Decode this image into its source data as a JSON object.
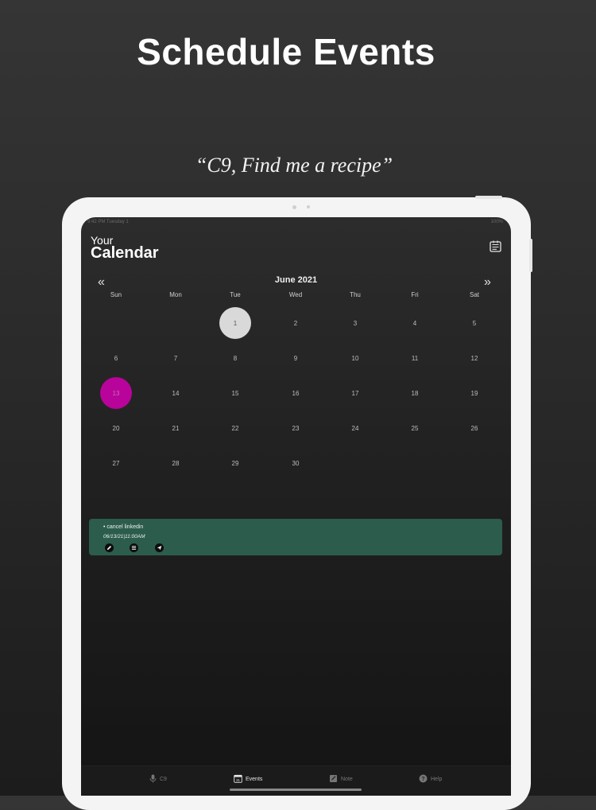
{
  "promo": {
    "headline": "Schedule Events",
    "quote": "“C9, Find me a recipe”"
  },
  "status_bar": {
    "left": "9:42 PM  Tuesday 1",
    "right": "100%"
  },
  "header": {
    "title_small": "Your",
    "title_big": "Calendar",
    "planner_icon": "planner-icon"
  },
  "calendar": {
    "month_label": "June 2021",
    "prev_label": "«",
    "next_label": "»",
    "weekdays": [
      "Sun",
      "Mon",
      "Tue",
      "Wed",
      "Thu",
      "Fri",
      "Sat"
    ],
    "today": "1",
    "selected": "13",
    "days": [
      "1",
      "2",
      "3",
      "4",
      "5",
      "6",
      "7",
      "8",
      "9",
      "10",
      "11",
      "12",
      "13",
      "14",
      "15",
      "16",
      "17",
      "18",
      "19",
      "20",
      "21",
      "22",
      "23",
      "24",
      "25",
      "26",
      "27",
      "28",
      "29",
      "30"
    ]
  },
  "event": {
    "title": "• cancel linkedin",
    "time": "06/13/21|11:00AM",
    "actions": [
      "edit-icon",
      "list-icon",
      "send-icon"
    ]
  },
  "tabs": [
    {
      "label": "C9",
      "icon": "microphone-icon",
      "active": false
    },
    {
      "label": "Events",
      "icon": "calendar-icon",
      "active": true
    },
    {
      "label": "Note",
      "icon": "note-icon",
      "active": false
    },
    {
      "label": "Help",
      "icon": "help-icon",
      "active": false
    }
  ],
  "colors": {
    "selected_day": "#b8049a",
    "today_day": "#d9d9d9",
    "event_card": "#2c5c4b"
  }
}
